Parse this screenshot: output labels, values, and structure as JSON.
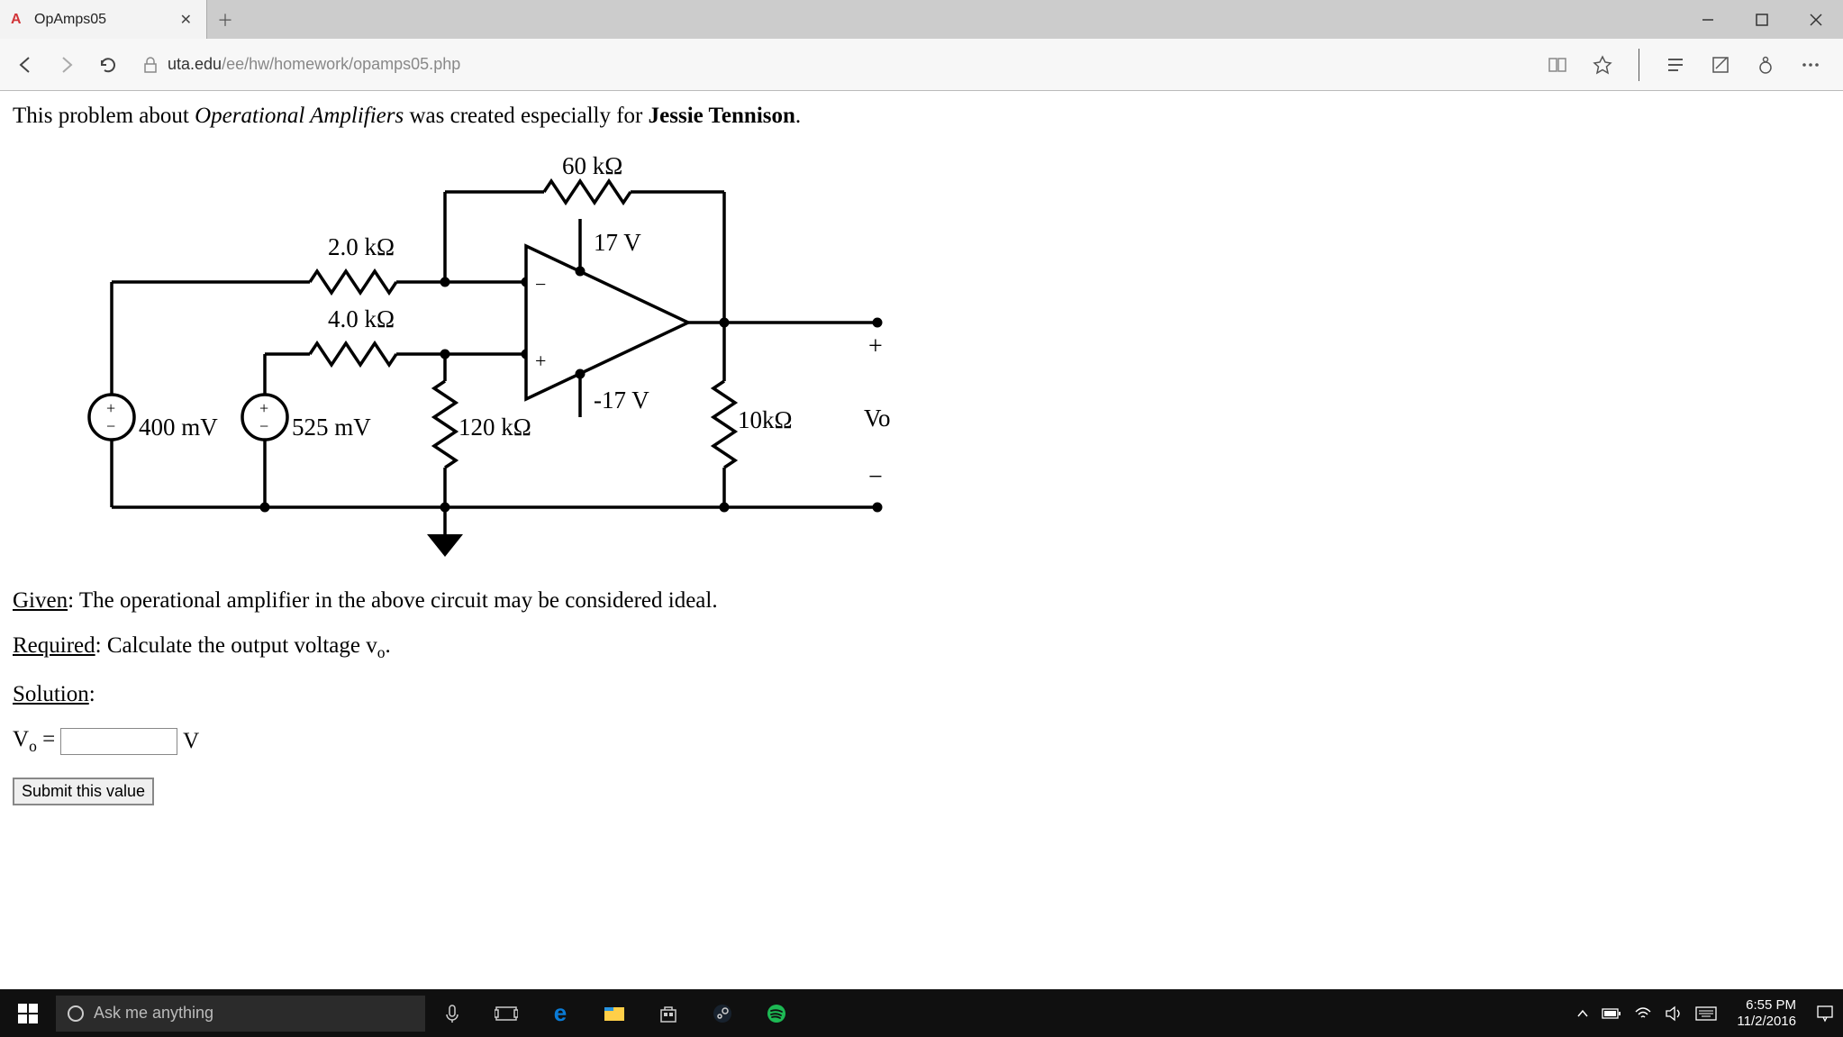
{
  "tab": {
    "title": "OpAmps05",
    "favicon": "A"
  },
  "url": {
    "domain": "uta.edu",
    "path": "/ee/hw/homework/opamps05.php"
  },
  "page": {
    "intro_prefix": "This problem about ",
    "intro_topic": "Operational Amplifiers",
    "intro_mid": " was created especially for ",
    "intro_name": "Jessie Tennison",
    "intro_suffix": ".",
    "given_label": "Given",
    "given_text": ": The operational amplifier in the above circuit may be considered ideal.",
    "required_label": "Required",
    "required_text": ": Calculate the output voltage v",
    "required_sub": "o",
    "required_suffix": ".",
    "solution_label": "Solution",
    "solution_suffix": ":",
    "answer_var": "V",
    "answer_sub": "o",
    "answer_eq": " = ",
    "answer_unit": " V",
    "answer_value": "",
    "submit": "Submit this value"
  },
  "circuit": {
    "R_feedback": "60 kΩ",
    "R_in_top": "2.0 kΩ",
    "R_in_bot": "4.0 kΩ",
    "V_src1": "400 mV",
    "V_src2": "525 mV",
    "R_ground": "120 kΩ",
    "V_pos_rail": "17 V",
    "V_neg_rail": "-17 V",
    "R_load": "10kΩ",
    "out_label": "Vo",
    "plus": "+",
    "minus": "−",
    "amp_minus": "−",
    "amp_plus": "+"
  },
  "cortana": {
    "placeholder": "Ask me anything"
  },
  "clock": {
    "time": "6:55 PM",
    "date": "11/2/2016"
  }
}
